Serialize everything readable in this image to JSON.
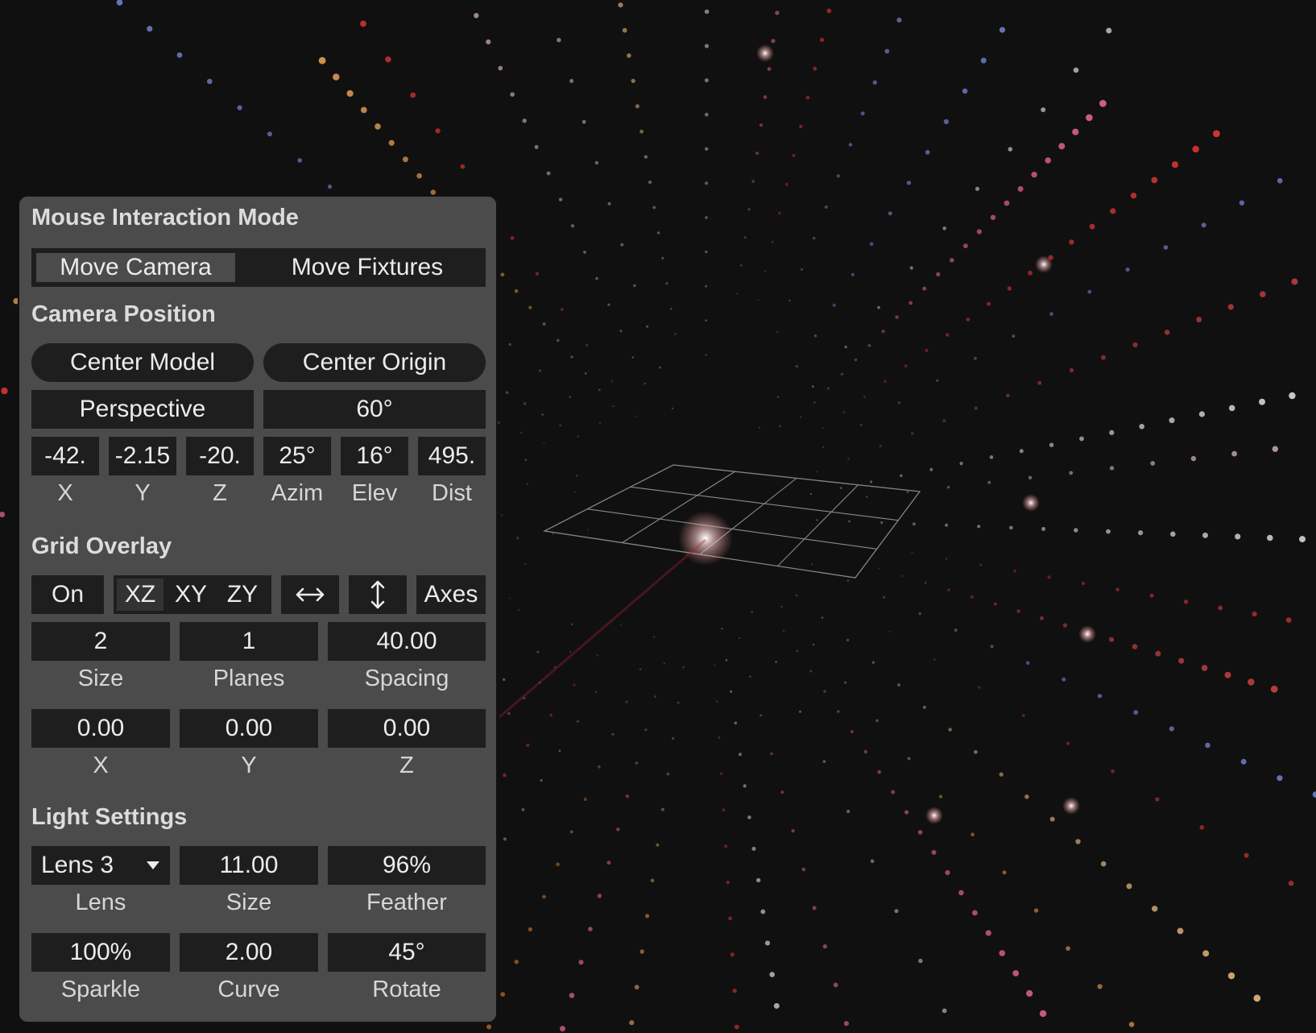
{
  "mouse_mode": {
    "title": "Mouse Interaction Mode",
    "options": [
      "Move Camera",
      "Move Fixtures"
    ],
    "selected": "Move Camera"
  },
  "camera": {
    "title": "Camera Position",
    "center_model": "Center Model",
    "center_origin": "Center Origin",
    "projection": "Perspective",
    "fov": "60°",
    "values": [
      "-42.",
      "-2.15",
      "-20.",
      "25°",
      "16°",
      "495."
    ],
    "labels": [
      "X",
      "Y",
      "Z",
      "Azim",
      "Elev",
      "Dist"
    ]
  },
  "grid": {
    "title": "Grid Overlay",
    "toggle": "On",
    "planes": [
      "XZ",
      "XY",
      "ZY"
    ],
    "selected_plane": "XZ",
    "axes_label": "Axes",
    "row1_values": [
      "2",
      "1",
      "40.00"
    ],
    "row1_labels": [
      "Size",
      "Planes",
      "Spacing"
    ],
    "row2_values": [
      "0.00",
      "0.00",
      "0.00"
    ],
    "row2_labels": [
      "X",
      "Y",
      "Z"
    ]
  },
  "light": {
    "title": "Light Settings",
    "lens": "Lens 3",
    "row1_values": [
      "11.00",
      "96%"
    ],
    "row1_labels": [
      "Lens",
      "Size",
      "Feather"
    ],
    "row2_values": [
      "100%",
      "2.00",
      "45°"
    ],
    "row2_labels": [
      "Sparkle",
      "Curve",
      "Rotate"
    ]
  },
  "colors": {
    "background": "#101010",
    "panel": "#4b4b4b",
    "field": "#1e1e1e",
    "text": "#ececec"
  },
  "icons": [
    "horizontal-arrows-icon",
    "vertical-arrows-icon",
    "dropdown-caret-icon"
  ]
}
